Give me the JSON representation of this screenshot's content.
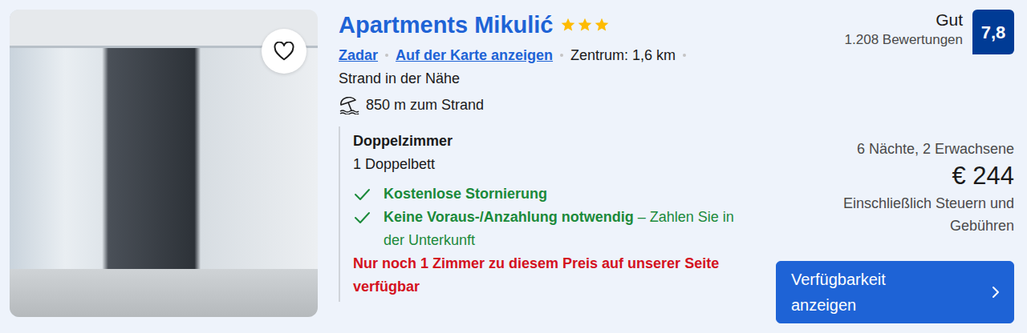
{
  "listing": {
    "name": "Apartments Mikulić",
    "stars": 3,
    "favorite": false,
    "city": "Zadar",
    "map_link": "Auf der Karte anzeigen",
    "center": "Zentrum: 1,6 km",
    "beach_note": "Strand in der Nähe",
    "beach_distance": "850 m zum Strand"
  },
  "room": {
    "name": "Doppelzimmer",
    "bed": "1 Doppelbett",
    "benefits": [
      {
        "title": "Kostenlose Stornierung",
        "detail": ""
      },
      {
        "title": "Keine Voraus-/Anzahlung notwendig",
        "detail": "– Zahlen Sie in der Unterkunft"
      }
    ],
    "scarcity": "Nur noch 1 Zimmer zu diesem Preis auf unserer Seite verfügbar"
  },
  "review": {
    "label": "Gut",
    "count": "1.208 Bewertungen",
    "score": "7,8"
  },
  "price": {
    "stay": "6 Nächte, 2 Erwachsene",
    "amount": "€ 244",
    "note": "Einschließlich Steuern und Gebühren"
  },
  "button": {
    "label": "Verfügbarkeit anzeigen"
  }
}
